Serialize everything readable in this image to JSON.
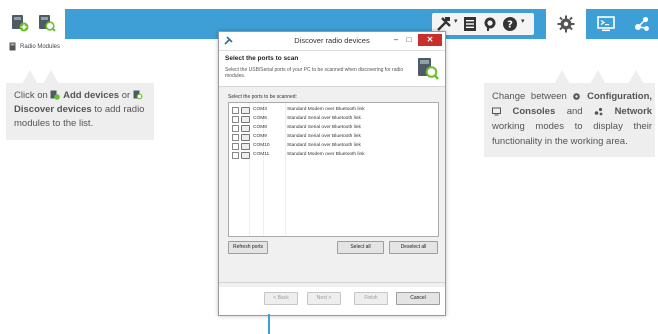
{
  "sidebar": {
    "radio_modules_label": "Radio Modules"
  },
  "callout_left": {
    "click_on": "Click on",
    "add_devices": "Add devices",
    "or": "or",
    "discover_devices": "Discover devices",
    "to_add": "to add radio modules to the list."
  },
  "callout_right": {
    "change_between": "Change between",
    "configuration": "Configuration,",
    "consoles": "Consoles",
    "and": "and",
    "network": "Network",
    "rest": "working modes to display their functionality in the working area."
  },
  "dialog": {
    "title": "Discover radio devices",
    "minimize": "–",
    "maximize": "□",
    "close": "✕",
    "heading": "Select the ports to scan",
    "description": "Select the USB/Serial ports of your PC to be scanned when discovering for radio modules.",
    "ports_label": "Select the ports to be scanned:",
    "ports": [
      {
        "name": "COM3",
        "desc": "Standard Modem over Bluetooth link"
      },
      {
        "name": "COM6",
        "desc": "Standard Serial over Bluetooth link"
      },
      {
        "name": "COM8",
        "desc": "Standard Serial over Bluetooth link"
      },
      {
        "name": "COM9",
        "desc": "Standard Serial over Bluetooth link"
      },
      {
        "name": "COM10",
        "desc": "Standard Serial over Bluetooth link"
      },
      {
        "name": "COM11",
        "desc": "Standard Modem over Bluetooth link"
      }
    ],
    "refresh_ports": "Refresh ports",
    "select_all": "Select all",
    "deselect_all": "Deselect all",
    "back": "< Back",
    "next": "Next >",
    "finish": "Finish",
    "cancel": "Cancel"
  },
  "colors": {
    "toolbar": "#3d9fd5",
    "callout_bg": "#eeeeee",
    "close_button": "#c9302c"
  },
  "icons": [
    "add-device-icon",
    "discover-device-icon",
    "tools-icon",
    "list-icon",
    "support-icon",
    "help-icon",
    "gear-icon",
    "console-icon",
    "network-icon"
  ]
}
